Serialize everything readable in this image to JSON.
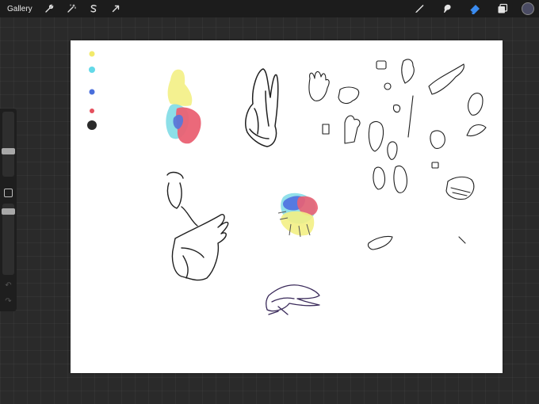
{
  "topbar": {
    "gallery_label": "Gallery",
    "left_tools": [
      "wrench-icon",
      "magic-wand-icon",
      "selection-icon",
      "transform-arrow-icon"
    ],
    "right_tools": [
      "brush-icon",
      "smudge-icon",
      "eraser-icon",
      "layers-icon"
    ],
    "active_tool": "eraser-icon",
    "current_color": "#4a4b63"
  },
  "palette_dots": [
    {
      "color": "#f2ea6a"
    },
    {
      "color": "#63d9e8"
    },
    {
      "color": "#4a6fdc"
    },
    {
      "color": "#e5505e"
    },
    {
      "color": "#2a2a2a"
    }
  ],
  "sidebar": {
    "brush_size_level": 0.55,
    "opacity_level": 0.1
  }
}
